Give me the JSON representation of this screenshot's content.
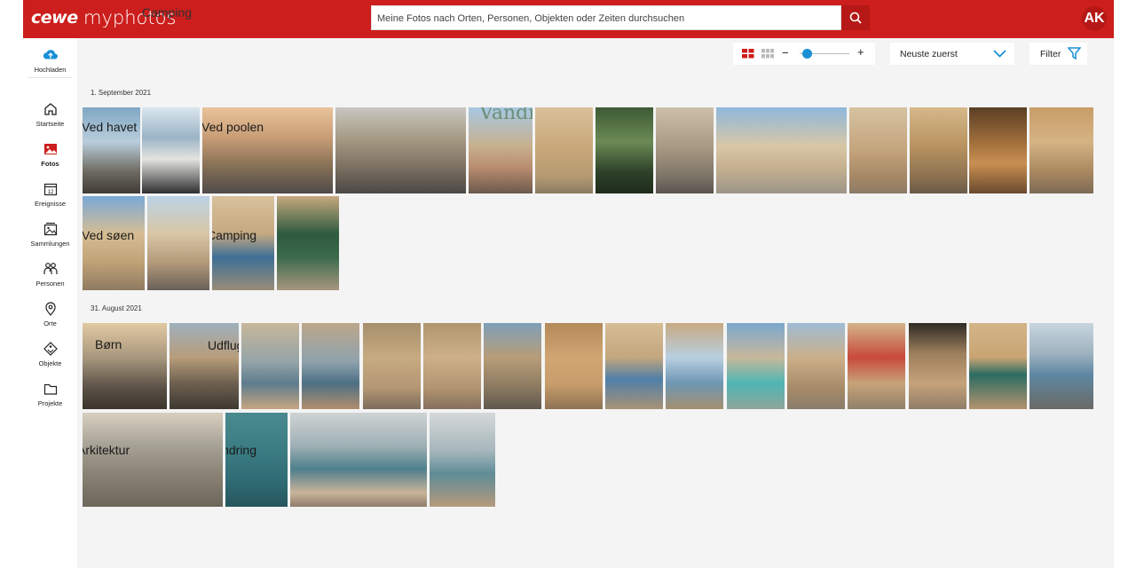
{
  "header": {
    "brand": "cewe",
    "product": "myphotos",
    "overlay_text": "Camping",
    "search_placeholder": "Meine Fotos nach Orten, Personen, Objekten oder Zeiten durchsuchen",
    "user_initials": "AK"
  },
  "colors": {
    "brand_red": "#cc1e1c",
    "accent_blue": "#1a8fd6",
    "background": "#f4f4f4"
  },
  "sidebar": {
    "upload_label": "Hochladen",
    "items": [
      {
        "label": "Startseite",
        "icon": "home-icon"
      },
      {
        "label": "Fotos",
        "icon": "photos-icon",
        "active": true
      },
      {
        "label": "Ereignisse",
        "icon": "calendar-icon"
      },
      {
        "label": "Sammlungen",
        "icon": "collections-icon"
      },
      {
        "label": "Personen",
        "icon": "people-icon"
      },
      {
        "label": "Orte",
        "icon": "location-icon"
      },
      {
        "label": "Objekte",
        "icon": "tag-icon"
      },
      {
        "label": "Projekte",
        "icon": "folder-icon"
      }
    ]
  },
  "toolbar": {
    "zoom_minus": "−",
    "zoom_plus": "+",
    "zoom_level": 0.15,
    "sort_label": "Neuste zuerst",
    "filter_label": "Filter"
  },
  "groups": [
    {
      "date": "1. September 2021",
      "tags": [
        "Ved havet",
        "Ved poolen",
        "Vandreture",
        "Ved søen",
        "Camping"
      ]
    },
    {
      "date": "31. August 2021",
      "tags": [
        "Børn",
        "Udflugter",
        "Arkitektur",
        "Vandring"
      ]
    }
  ]
}
